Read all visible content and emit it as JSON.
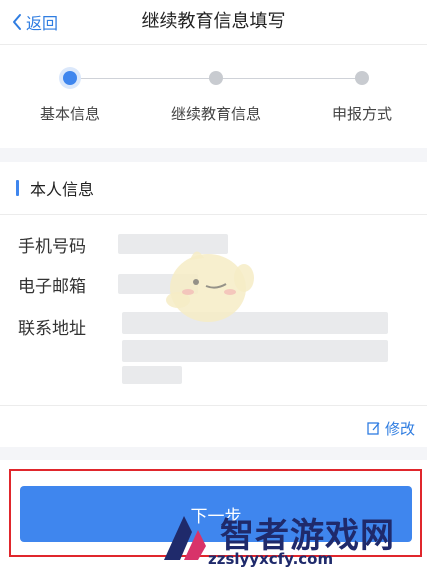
{
  "nav": {
    "back_label": "返回",
    "title": "继续教育信息填写"
  },
  "steps": [
    {
      "label": "基本信息",
      "active": true
    },
    {
      "label": "继续教育信息",
      "active": false
    },
    {
      "label": "申报方式",
      "active": false
    }
  ],
  "section": {
    "title": "本人信息",
    "rows": [
      {
        "label": "手机号码"
      },
      {
        "label": "电子邮箱"
      },
      {
        "label": "联系地址"
      }
    ]
  },
  "edit_label": "修改",
  "next_label": "下一步",
  "watermark": {
    "name": "智者游戏网",
    "url": "zzslyyxcfy.com"
  },
  "colors": {
    "accent": "#3f86ee",
    "link": "#2f7de1",
    "highlight": "#e0262c"
  }
}
